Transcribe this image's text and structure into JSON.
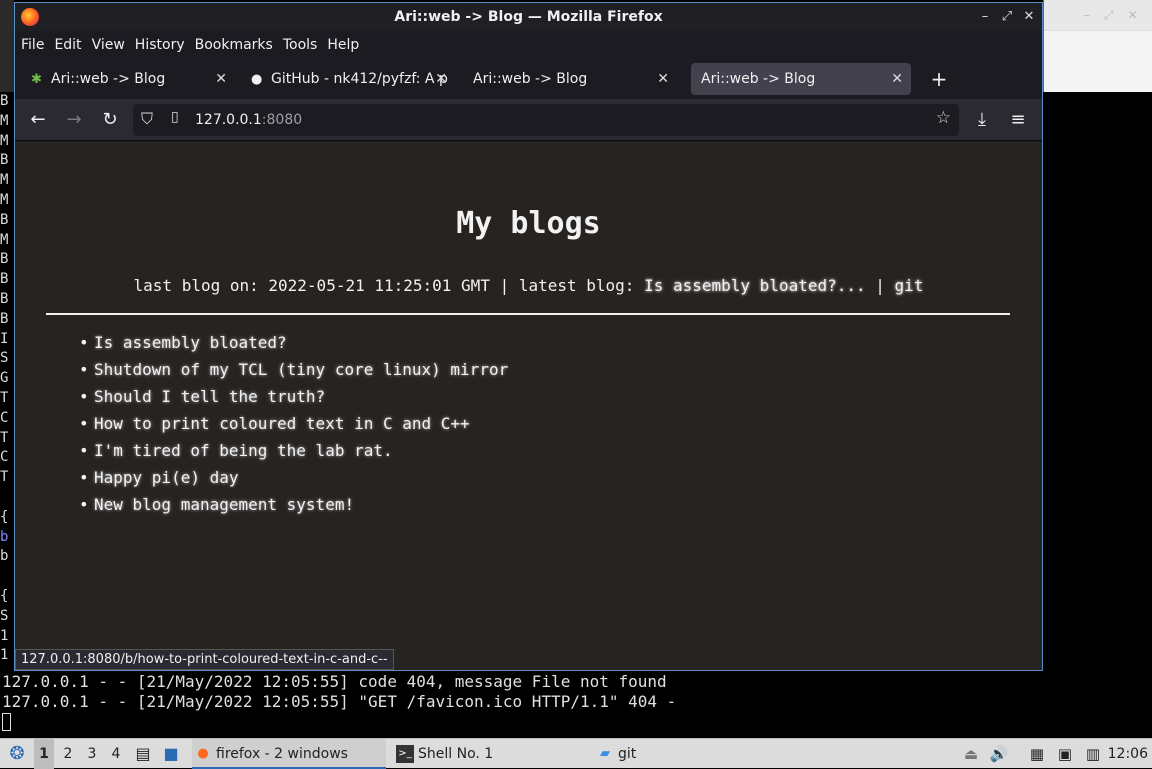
{
  "window": {
    "title": "Ari::web -> Blog — Mozilla Firefox",
    "controls": [
      "–",
      "⤢",
      "✕"
    ]
  },
  "menu": [
    "File",
    "Edit",
    "View",
    "History",
    "Bookmarks",
    "Tools",
    "Help"
  ],
  "tabs": [
    {
      "label": "Ari::web -> Blog",
      "icon": "tcl-icon"
    },
    {
      "label": "GitHub - nk412/pyfzf: A p",
      "icon": "github-icon"
    },
    {
      "label": "Ari::web -> Blog",
      "icon": ""
    },
    {
      "label": "Ari::web -> Blog",
      "icon": ""
    }
  ],
  "urlbar": {
    "host": "127.0.0.1",
    "port": ":8080"
  },
  "page": {
    "title": "My blogs",
    "meta_prefix": "last blog on: 2022-05-21 11:25:01 GMT | latest blog: ",
    "latest_link": "Is assembly bloated?...",
    "separator": " | ",
    "git_link": "git",
    "posts": [
      "Is assembly bloated?",
      "Shutdown of my TCL (tiny core linux) mirror",
      "Should I tell the truth?",
      "How to print coloured text in C and C++",
      "I'm tired of being the lab rat.",
      "Happy pi(e) day",
      "New blog management system!"
    ],
    "hover_status": "127.0.0.1:8080/b/how-to-print-coloured-text-in-c-and-c--"
  },
  "terminal": {
    "left_column": [
      "B",
      "M",
      "M",
      "B",
      "M",
      "M",
      "B",
      "M",
      "B",
      "B",
      "B",
      "B",
      "I",
      "S",
      "G",
      "T",
      "C",
      "T",
      "C",
      "T",
      "",
      "{",
      "b",
      "b",
      "",
      "{",
      "S",
      "1",
      "1"
    ],
    "log_lines": [
      "127.0.0.1 - - [21/May/2022 12:05:55] code 404, message File not found",
      "127.0.0.1 - - [21/May/2022 12:05:55] \"GET /favicon.ico HTTP/1.1\" 404 -"
    ]
  },
  "taskbar": {
    "workspaces": [
      "1",
      "2",
      "3",
      "4"
    ],
    "tasks": [
      {
        "label": "firefox - 2 windows",
        "icon": "firefox-icon"
      },
      {
        "label": "Shell No. 1",
        "icon": "terminal-icon"
      },
      {
        "label": "git",
        "icon": "folder-icon"
      }
    ],
    "clock": "12:06"
  },
  "colors": {
    "page_bg": "#272321",
    "accent": "#2a6bb5"
  }
}
